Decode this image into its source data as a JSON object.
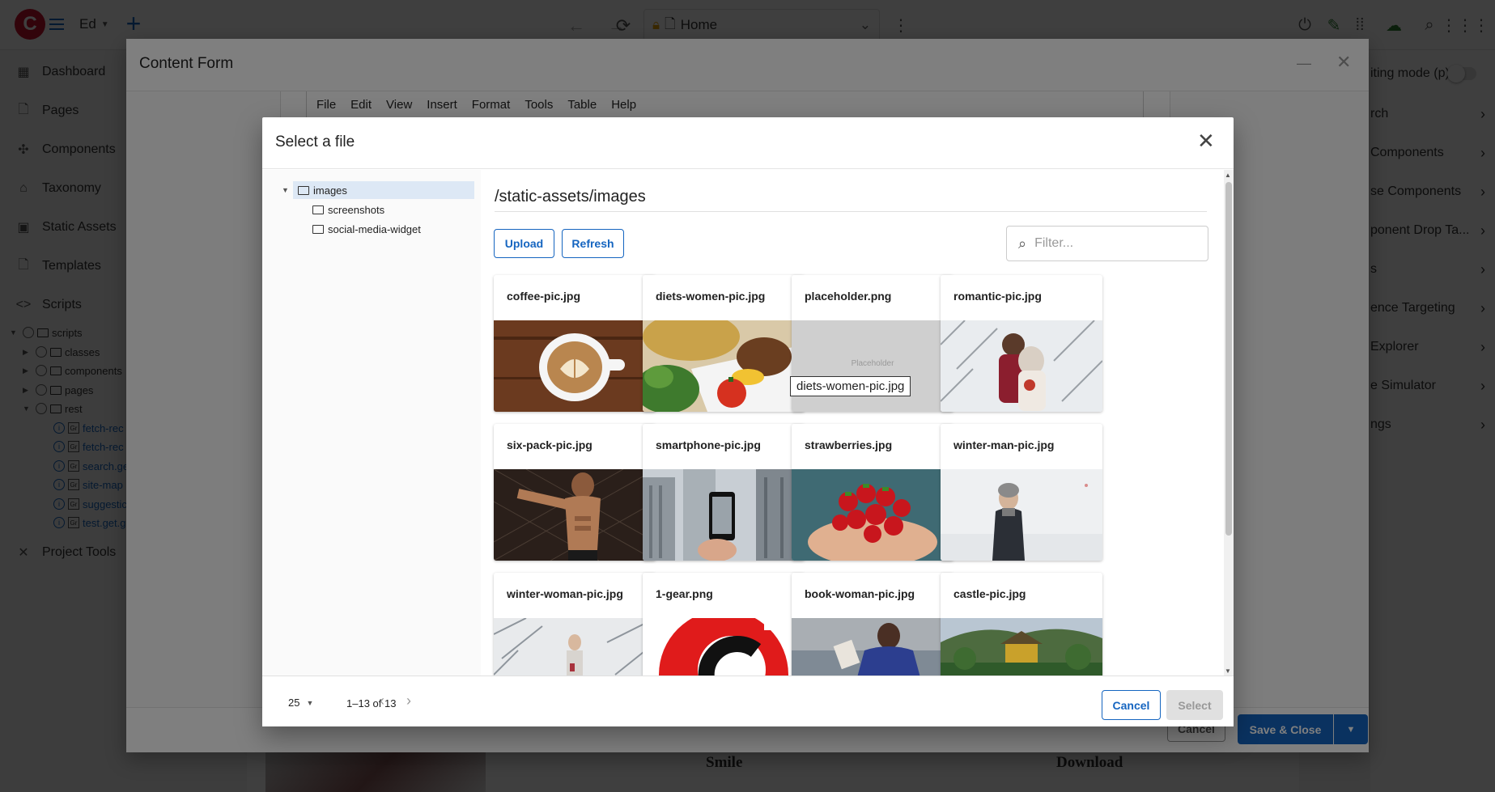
{
  "topbar": {
    "site": "Ed",
    "address": "Home",
    "logo_letter": "C"
  },
  "sidebar": {
    "items": [
      {
        "label": "Dashboard",
        "icon": "dashboard-icon"
      },
      {
        "label": "Pages",
        "icon": "page-icon"
      },
      {
        "label": "Components",
        "icon": "puzzle-icon"
      },
      {
        "label": "Taxonomy",
        "icon": "tag-icon"
      },
      {
        "label": "Static Assets",
        "icon": "image-icon"
      },
      {
        "label": "Templates",
        "icon": "template-icon"
      },
      {
        "label": "Scripts",
        "icon": "code-icon"
      }
    ],
    "tree": [
      {
        "label": "scripts",
        "type": "folder",
        "expanded": true
      },
      {
        "label": "classes",
        "type": "folder"
      },
      {
        "label": "components",
        "type": "folder"
      },
      {
        "label": "pages",
        "type": "folder"
      },
      {
        "label": "rest",
        "type": "folder",
        "expanded": true
      },
      {
        "label": "fetch-rec",
        "type": "script"
      },
      {
        "label": "fetch-rec",
        "type": "script"
      },
      {
        "label": "search.ge",
        "type": "script"
      },
      {
        "label": "site-map",
        "type": "script"
      },
      {
        "label": "suggestic",
        "type": "script"
      },
      {
        "label": "test.get.g",
        "type": "script"
      }
    ],
    "project_tools": "Project Tools"
  },
  "rightpanel": {
    "editing_mode": "iting mode (p)",
    "items": [
      "rch",
      "Components",
      "se Components",
      "ponent Drop Ta...",
      "s",
      "ence Targeting",
      "Explorer",
      "e Simulator",
      "ngs"
    ]
  },
  "background": {
    "preview_left": "Smile",
    "preview_right": "Download"
  },
  "content_form": {
    "title": "Content Form",
    "menu": [
      "File",
      "Edit",
      "View",
      "Insert",
      "Format",
      "Tools",
      "Table",
      "Help"
    ],
    "cancel_label": "Cancel",
    "save_label": "Save & Close"
  },
  "select_file": {
    "title": "Select a file",
    "tree": {
      "root": "images",
      "children": [
        "screenshots",
        "social-media-widget"
      ]
    },
    "path": "/static-assets/images",
    "upload_label": "Upload",
    "refresh_label": "Refresh",
    "filter_placeholder": "Filter...",
    "files": [
      {
        "name": "coffee-pic.jpg"
      },
      {
        "name": "diets-women-pic.jpg"
      },
      {
        "name": "placeholder.png",
        "thumb_text": "Placeholder"
      },
      {
        "name": "romantic-pic.jpg"
      },
      {
        "name": "six-pack-pic.jpg"
      },
      {
        "name": "smartphone-pic.jpg"
      },
      {
        "name": "strawberries.jpg"
      },
      {
        "name": "winter-man-pic.jpg"
      },
      {
        "name": "winter-woman-pic.jpg"
      },
      {
        "name": "1-gear.png"
      },
      {
        "name": "book-woman-pic.jpg"
      },
      {
        "name": "castle-pic.jpg"
      }
    ],
    "tooltip": "diets-women-pic.jpg",
    "page_size": "25",
    "range": "1–13 of 13",
    "cancel_label": "Cancel",
    "select_label": "Select"
  }
}
